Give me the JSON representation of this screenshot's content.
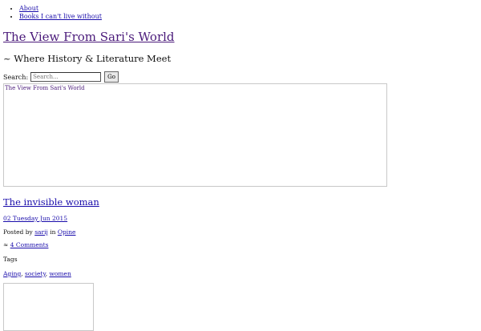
{
  "nav": {
    "items": [
      {
        "label": "About"
      },
      {
        "label": "Books I can't live without"
      }
    ]
  },
  "site": {
    "title": "The View From Sari's World",
    "tagline": "~ Where History & Literature Meet"
  },
  "search": {
    "label": "Search:",
    "placeholder": "Search...",
    "button_label": "Go"
  },
  "header_image": {
    "alt_text": "The View From Sari's World"
  },
  "post": {
    "title": "The invisible woman",
    "date": "02 Tuesday Jun 2015",
    "posted_by_prefix": "Posted by",
    "author": "sarij",
    "in_word": "in",
    "category": "Opine",
    "comments_prefix": "≈",
    "comments": "4 Comments",
    "tags_label": "Tags",
    "tags": [
      "Aging",
      "society",
      "women"
    ]
  },
  "colors": {
    "link": "#1a0dab",
    "visited_link": "#4a1a7a",
    "border": "#c8c8c8"
  }
}
